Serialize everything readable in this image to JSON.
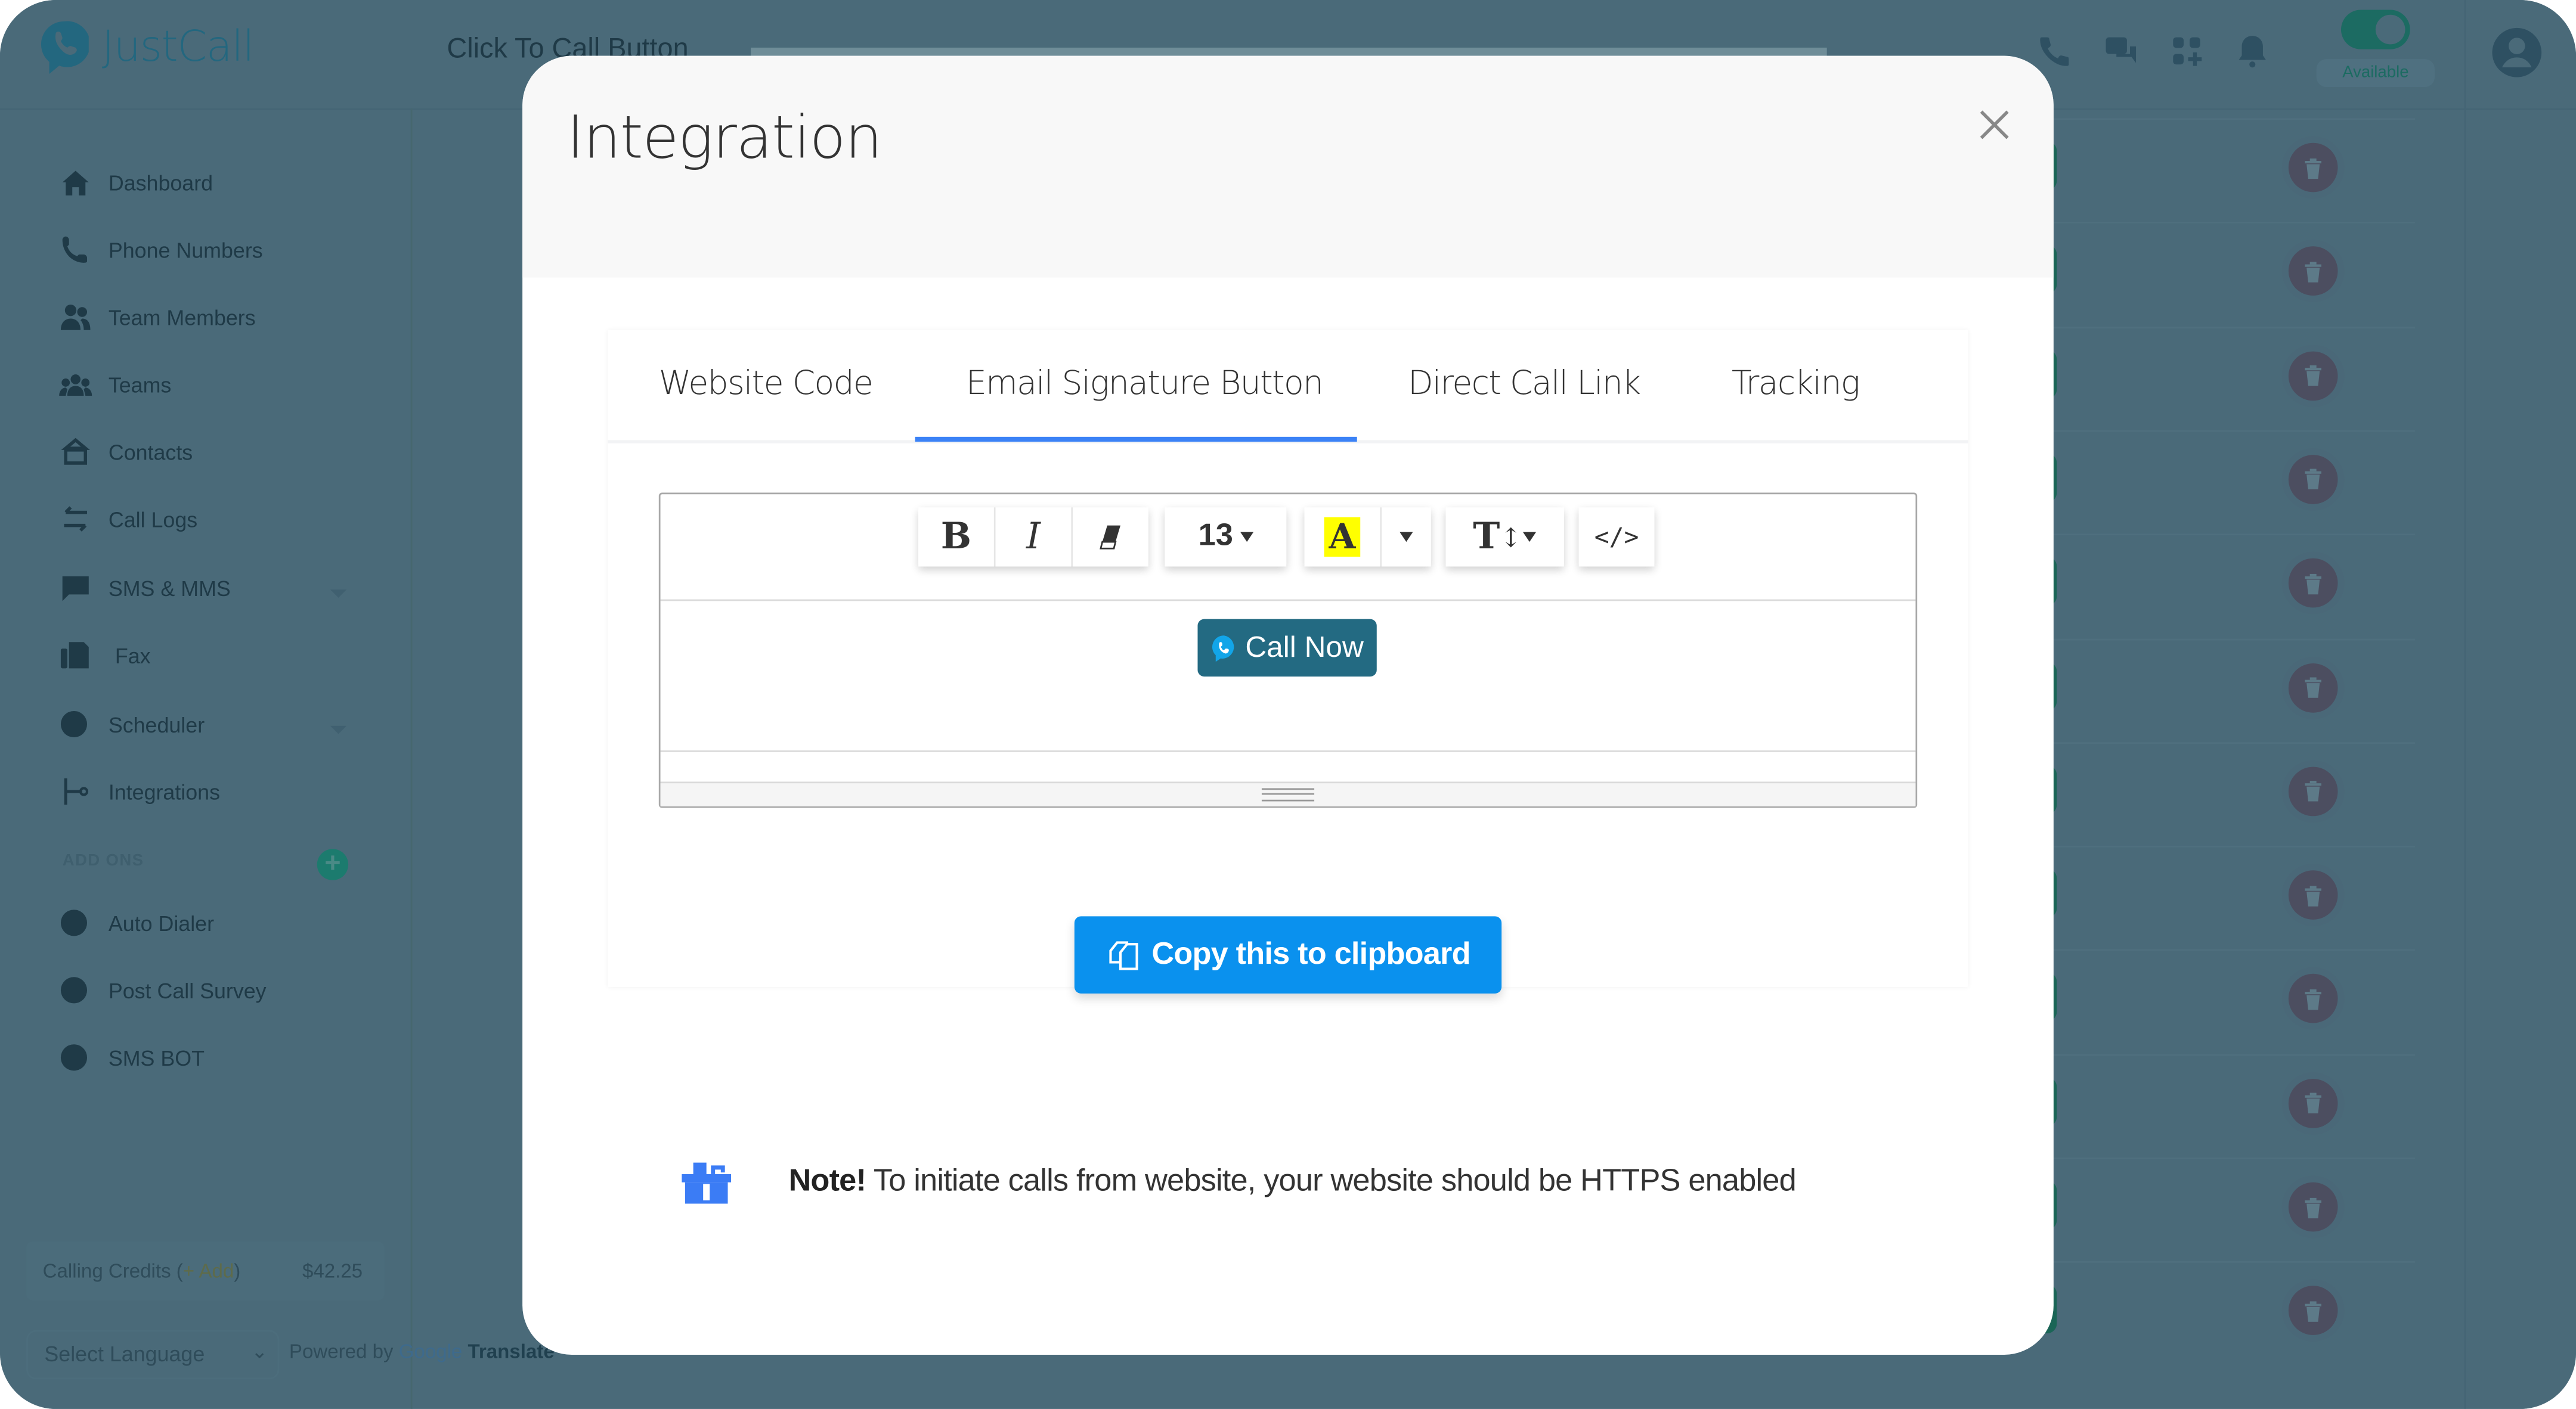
{
  "app": {
    "brand": "JustCall",
    "page_title": "Click To Call Button",
    "status": {
      "label": "Available",
      "toggle_on": true
    },
    "top_icons": [
      "phone-icon",
      "chat-icon",
      "apps-grid-icon",
      "bell-icon"
    ],
    "colors": {
      "overlay_bg": "#4a6a79",
      "brand": "#23677f",
      "available_green": "#1c6b62"
    }
  },
  "sidebar": {
    "items": [
      {
        "label": "Dashboard",
        "icon": "home-icon"
      },
      {
        "label": "Phone Numbers",
        "icon": "phone-icon"
      },
      {
        "label": "Team Members",
        "icon": "users-icon"
      },
      {
        "label": "Teams",
        "icon": "team-icon"
      },
      {
        "label": "Contacts",
        "icon": "contacts-icon"
      },
      {
        "label": "Call Logs",
        "icon": "arrows-swap-icon"
      },
      {
        "label": "SMS & MMS",
        "icon": "message-icon",
        "expandable": true
      },
      {
        "label": "Fax",
        "icon": "fax-icon"
      },
      {
        "label": "Scheduler",
        "icon": "clock-icon",
        "expandable": true
      },
      {
        "label": "Integrations",
        "icon": "integrations-icon"
      }
    ],
    "addons_label": "ADD ONS",
    "addons": [
      {
        "label": "Auto Dialer",
        "icon": "clock-icon"
      },
      {
        "label": "Post Call Survey",
        "icon": "clock-icon"
      },
      {
        "label": "SMS BOT",
        "icon": "clock-icon"
      }
    ],
    "credits": {
      "label": "Calling Credits (",
      "add": "+ Add",
      "close": ")",
      "amount": "$42.25"
    },
    "language": {
      "selected": "Select Language",
      "powered_by": "Powered by",
      "google": "Google",
      "translate": "Translate"
    }
  },
  "background_rows": {
    "count": 12,
    "action_icon": "trash-icon"
  },
  "modal": {
    "title": "Integration",
    "close_icon": "close-icon",
    "tabs": [
      {
        "label": "Website Code",
        "active": false
      },
      {
        "label": "Email Signature Button",
        "active": true
      },
      {
        "label": "Direct Call Link",
        "active": false
      },
      {
        "label": "Tracking",
        "active": false
      }
    ],
    "editor": {
      "toolbar": {
        "bold": "B",
        "italic": "I",
        "font_size": "13",
        "highlight": "A",
        "line_height": "T",
        "code": "</>"
      },
      "content_button_label": "Call Now"
    },
    "copy_button_label": "Copy this to clipboard",
    "note": {
      "bold": "Note!",
      "text": " To initiate calls from website, your website should be HTTPS enabled"
    },
    "colors": {
      "tab_active_underline": "#3b82f6",
      "copy_button": "#0a91ee",
      "call_now_button": "#236a82",
      "highlight": "#ffff00",
      "note_icon": "#3b7cf5"
    }
  }
}
